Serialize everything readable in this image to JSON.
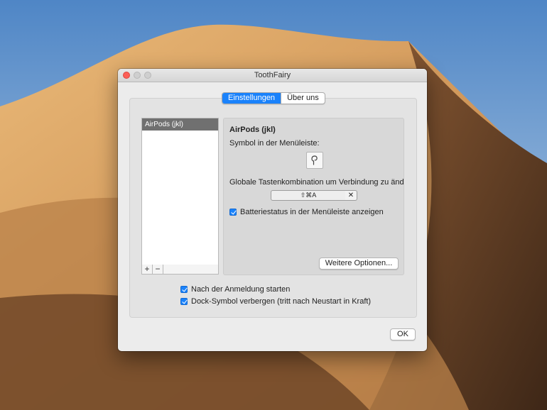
{
  "window": {
    "title": "ToothFairy"
  },
  "tabs": [
    {
      "label": "Einstellungen",
      "active": true
    },
    {
      "label": "Über uns",
      "active": false
    }
  ],
  "devices": {
    "items": [
      {
        "label": "AirPods (jkl)",
        "selected": true
      }
    ],
    "add_label": "+",
    "remove_label": "−"
  },
  "detail": {
    "title": "AirPods (jkl)",
    "symbol_label": "Symbol in der Menüleiste:",
    "symbol_icon": "airpod-icon",
    "shortcut_label": "Globale Tastenkombination um Verbindung zu ände",
    "shortcut_value": "⇧⌘A",
    "shortcut_clear": "✕",
    "battery_label": "Batteriestatus in der Menüleiste anzeigen",
    "battery_checked": true,
    "more_button": "Weitere Optionen..."
  },
  "general": {
    "launch_label": "Nach der Anmeldung starten",
    "launch_checked": true,
    "dock_label": "Dock-Symbol verbergen (tritt nach Neustart in Kraft)",
    "dock_checked": true
  },
  "ok_button": "OK",
  "colors": {
    "accent": "#1a82fb",
    "close": "#fc5f57"
  }
}
